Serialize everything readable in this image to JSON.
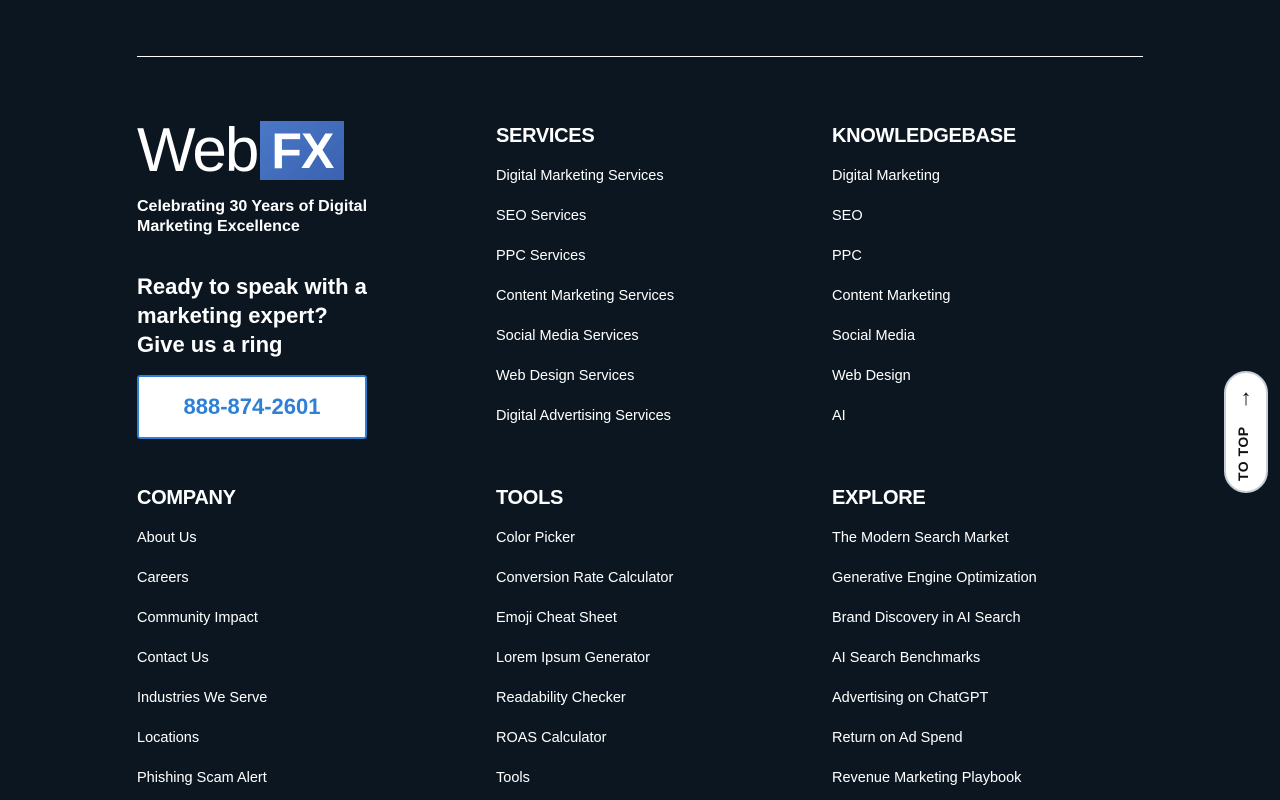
{
  "brand": {
    "logo_text_web": "Web",
    "logo_text_fx": "FX",
    "tagline": "Celebrating 30 Years of Digital Marketing Excellence",
    "cta_heading": "Ready to speak with a marketing expert? Give us a ring",
    "phone": "888-874-2601"
  },
  "services": {
    "heading": "SERVICES",
    "items": [
      "Digital Marketing Services",
      "SEO Services",
      "PPC Services",
      "Content Marketing Services",
      "Social Media Services",
      "Web Design Services",
      "Digital Advertising Services"
    ]
  },
  "knowledgebase": {
    "heading": "KNOWLEDGEBASE",
    "items": [
      "Digital Marketing",
      "SEO",
      "PPC",
      "Content Marketing",
      "Social Media",
      "Web Design",
      "AI"
    ]
  },
  "company": {
    "heading": "COMPANY",
    "items": [
      "About Us",
      "Careers",
      "Community Impact",
      "Contact Us",
      "Industries We Serve",
      "Locations",
      "Phishing Scam Alert"
    ]
  },
  "tools": {
    "heading": "TOOLS",
    "items": [
      "Color Picker",
      "Conversion Rate Calculator",
      "Emoji Cheat Sheet",
      "Lorem Ipsum Generator",
      "Readability Checker",
      "ROAS Calculator",
      "Tools"
    ]
  },
  "explore": {
    "heading": "EXPLORE",
    "items": [
      "The Modern Search Market",
      "Generative Engine Optimization",
      "Brand Discovery in AI Search",
      "AI Search Benchmarks",
      "Advertising on ChatGPT",
      "Return on Ad Spend",
      "Revenue Marketing Playbook"
    ]
  },
  "to_top": {
    "label": "TO TOP",
    "icon": "arrow-up-icon"
  },
  "colors": {
    "background": "#0b1620",
    "accent": "#2e7fd6",
    "logo_fx": "#4a78c7"
  }
}
